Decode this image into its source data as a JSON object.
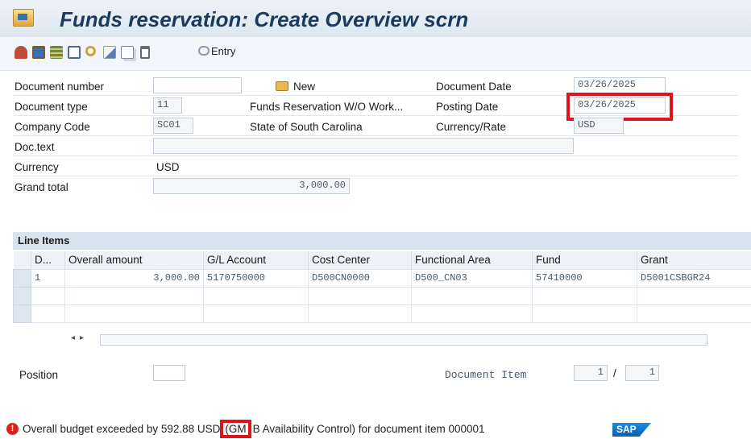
{
  "title": "Funds reservation: Create Overview scrn",
  "toolbar": {
    "icons": [
      "print-icon",
      "save-icon",
      "stack-icon",
      "table-icon",
      "search-icon",
      "edit-icon",
      "copy-icon",
      "delete-icon"
    ],
    "entry_label": "Entry"
  },
  "header": {
    "doc_number_label": "Document number",
    "doc_number_value": "",
    "new_label": "New",
    "doc_date_label": "Document Date",
    "doc_date_value": "03/26/2025",
    "doc_type_label": "Document type",
    "doc_type_value": "11",
    "doc_type_desc": "Funds Reservation W/O Work...",
    "posting_date_label": "Posting Date",
    "posting_date_value": "03/26/2025",
    "company_code_label": "Company Code",
    "company_code_value": "SC01",
    "company_code_desc": "State of South Carolina",
    "currency_rate_label": "Currency/Rate",
    "currency_rate_value": "USD",
    "doc_text_label": "Doc.text",
    "doc_text_value": "",
    "currency_label": "Currency",
    "currency_value": "USD",
    "grand_total_label": "Grand total",
    "grand_total_value": "3,000.00"
  },
  "line_items": {
    "title": "Line Items",
    "columns": [
      "D...",
      "Overall amount",
      "G/L Account",
      "Cost Center",
      "Functional Area",
      "Fund",
      "Grant"
    ],
    "rows": [
      [
        "1",
        "3,000.00",
        "5170750000",
        "D500CN0000",
        "D500_CN03",
        "57410000",
        "D5001CSBGR24"
      ],
      [
        "",
        "",
        "",
        "",
        "",
        "",
        ""
      ],
      [
        "",
        "",
        "",
        "",
        "",
        "",
        ""
      ]
    ]
  },
  "position": {
    "label": "Position",
    "value": "",
    "doc_item_label": "Document Item",
    "doc_item_current": "1",
    "doc_item_separator": "/",
    "doc_item_total": "1"
  },
  "status": {
    "message_prefix": "Overall budget exceeded by 592.88 USD",
    "highlight": "(GM",
    "message_suffix": "B Availability Control) for document item 000001",
    "logo_text": "SAP"
  },
  "colors": {
    "highlight_border": "#e0131b",
    "title_text": "#1c3a5e",
    "error": "#d9221c"
  }
}
